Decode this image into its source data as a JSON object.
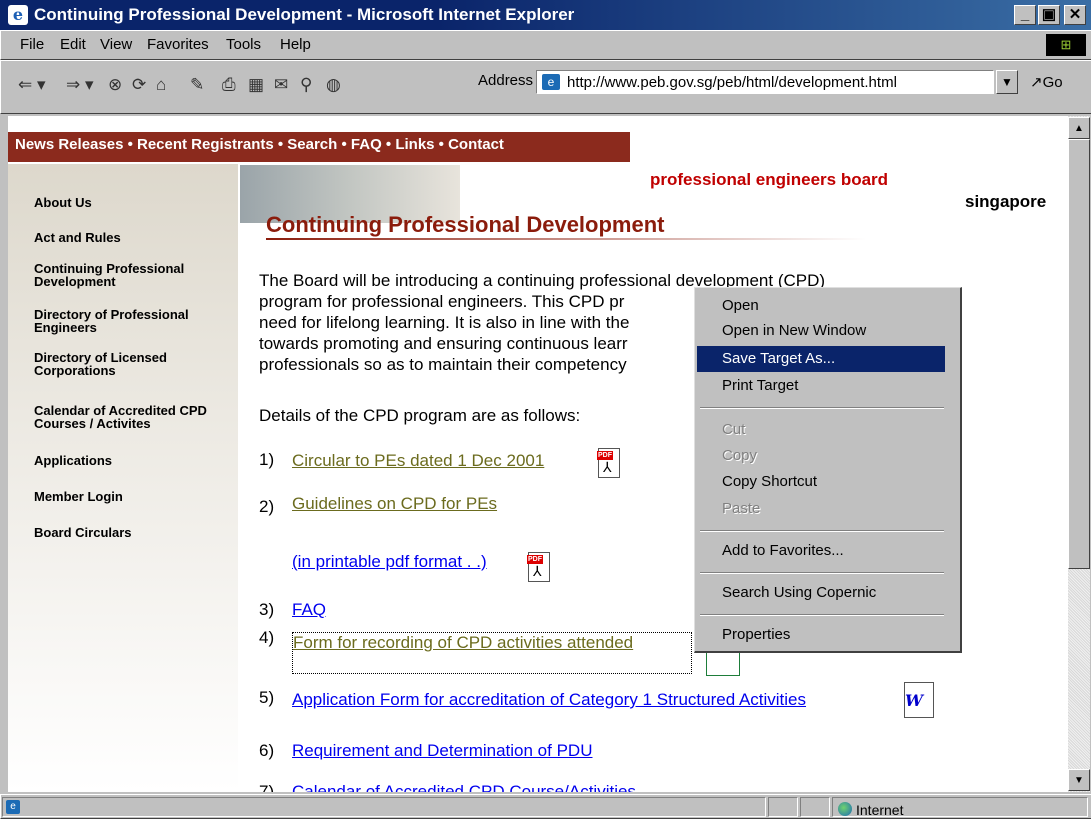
{
  "window": {
    "title": "Continuing Professional Development - Microsoft Internet Explorer"
  },
  "menubar": {
    "items": [
      {
        "label": "File"
      },
      {
        "label": "Edit"
      },
      {
        "label": "View"
      },
      {
        "label": "Favorites"
      },
      {
        "label": "Tools"
      },
      {
        "label": "Help"
      }
    ]
  },
  "toolbar": {
    "address_label": "Address",
    "address_value": "http://www.peb.gov.sg/peb/html/development.html",
    "go_label": "Go"
  },
  "page": {
    "nav_bar": "News Releases • Recent Registrants • Search • FAQ • Links • Contact",
    "org_name": "professional engineers board",
    "org_country": "singapore",
    "heading": "Continuing Professional Development",
    "intro_lines": [
      "The Board will be introducing a continuing professional development (CPD)",
      "program for professional engineers. This CPD pr",
      "need for lifelong learning. It is also in line with the",
      "towards promoting and ensuring continuous learr",
      "professionals so as to maintain their competency"
    ],
    "details_text": "Details of the CPD program are as follows:",
    "sidebar": [
      "About Us",
      "Act and Rules",
      "Continuing Professional Development",
      "Directory of Professional Engineers",
      "Directory of Licensed Corporations",
      "Calendar of Accredited CPD Courses / Activites",
      "Applications",
      "Member Login",
      "Board Circulars"
    ],
    "items": [
      {
        "num": "1)",
        "label": "Circular to PEs dated 1 Dec 2001"
      },
      {
        "num": "2)",
        "label": "Guidelines on CPD for PEs"
      },
      {
        "num": "",
        "label": "(in printable pdf format . .)"
      },
      {
        "num": "3)",
        "label": "FAQ"
      },
      {
        "num": "4)",
        "label": "Form for recording of CPD activities attended"
      },
      {
        "num": "5)",
        "label": "Application Form for accreditation of Category 1 Structured Activities"
      },
      {
        "num": "6)",
        "label": "Requirement and Determination of PDU"
      },
      {
        "num": "7)",
        "label": "Calendar of Accredited CPD Course/Activities"
      }
    ],
    "pdf_tag": "PDF"
  },
  "context_menu": {
    "items": [
      {
        "label": "Open"
      },
      {
        "label": "Open in New Window"
      },
      {
        "label": "Save Target As..."
      },
      {
        "label": "Print Target"
      },
      {
        "label": "Cut"
      },
      {
        "label": "Copy"
      },
      {
        "label": "Copy Shortcut"
      },
      {
        "label": "Paste"
      },
      {
        "label": "Add to Favorites..."
      },
      {
        "label": "Search Using Copernic"
      },
      {
        "label": "Properties"
      }
    ],
    "selected": "Save Target As..."
  },
  "statusbar": {
    "zone": "Internet"
  },
  "colors": {
    "titlebar": "#0a246a",
    "nav_bar": "#8b2a1d",
    "org_name": "#c00000",
    "link_visited": "#6b6b1e",
    "link": "#0000ee",
    "menu_highlight": "#0a246a"
  }
}
